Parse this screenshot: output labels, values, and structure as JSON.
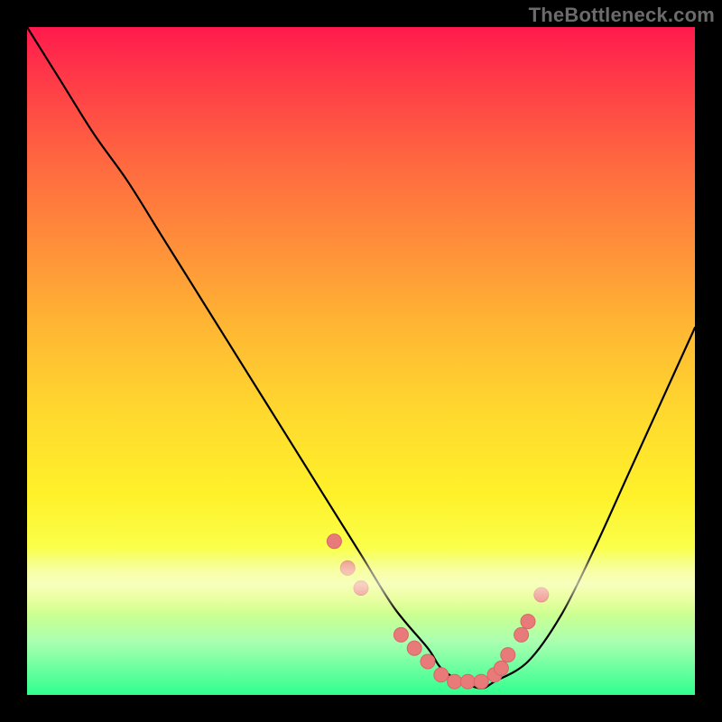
{
  "watermark": "TheBottleneck.com",
  "chart_data": {
    "type": "line",
    "title": "",
    "xlabel": "",
    "ylabel": "",
    "xlim": [
      0,
      100
    ],
    "ylim": [
      0,
      100
    ],
    "grid": false,
    "legend": false,
    "series": [
      {
        "name": "bottleneck-curve",
        "x": [
          0,
          5,
          10,
          15,
          20,
          25,
          30,
          35,
          40,
          45,
          50,
          55,
          60,
          62,
          65,
          68,
          70,
          75,
          80,
          85,
          90,
          95,
          100
        ],
        "y": [
          100,
          92,
          84,
          77,
          69,
          61,
          53,
          45,
          37,
          29,
          21,
          13,
          7,
          4,
          2,
          1,
          2,
          5,
          12,
          22,
          33,
          44,
          55
        ],
        "color": "#000000"
      }
    ],
    "scatter_points": {
      "name": "dots",
      "x": [
        46,
        48,
        50,
        56,
        58,
        60,
        62,
        64,
        66,
        68,
        70,
        71,
        72,
        74,
        75,
        77
      ],
      "y": [
        23,
        19,
        16,
        9,
        7,
        5,
        3,
        2,
        2,
        2,
        3,
        4,
        6,
        9,
        11,
        15
      ],
      "color": "#e97a7a"
    },
    "background_gradient": {
      "top": "#ff1a4d",
      "bottom": "#2fff8f"
    }
  }
}
